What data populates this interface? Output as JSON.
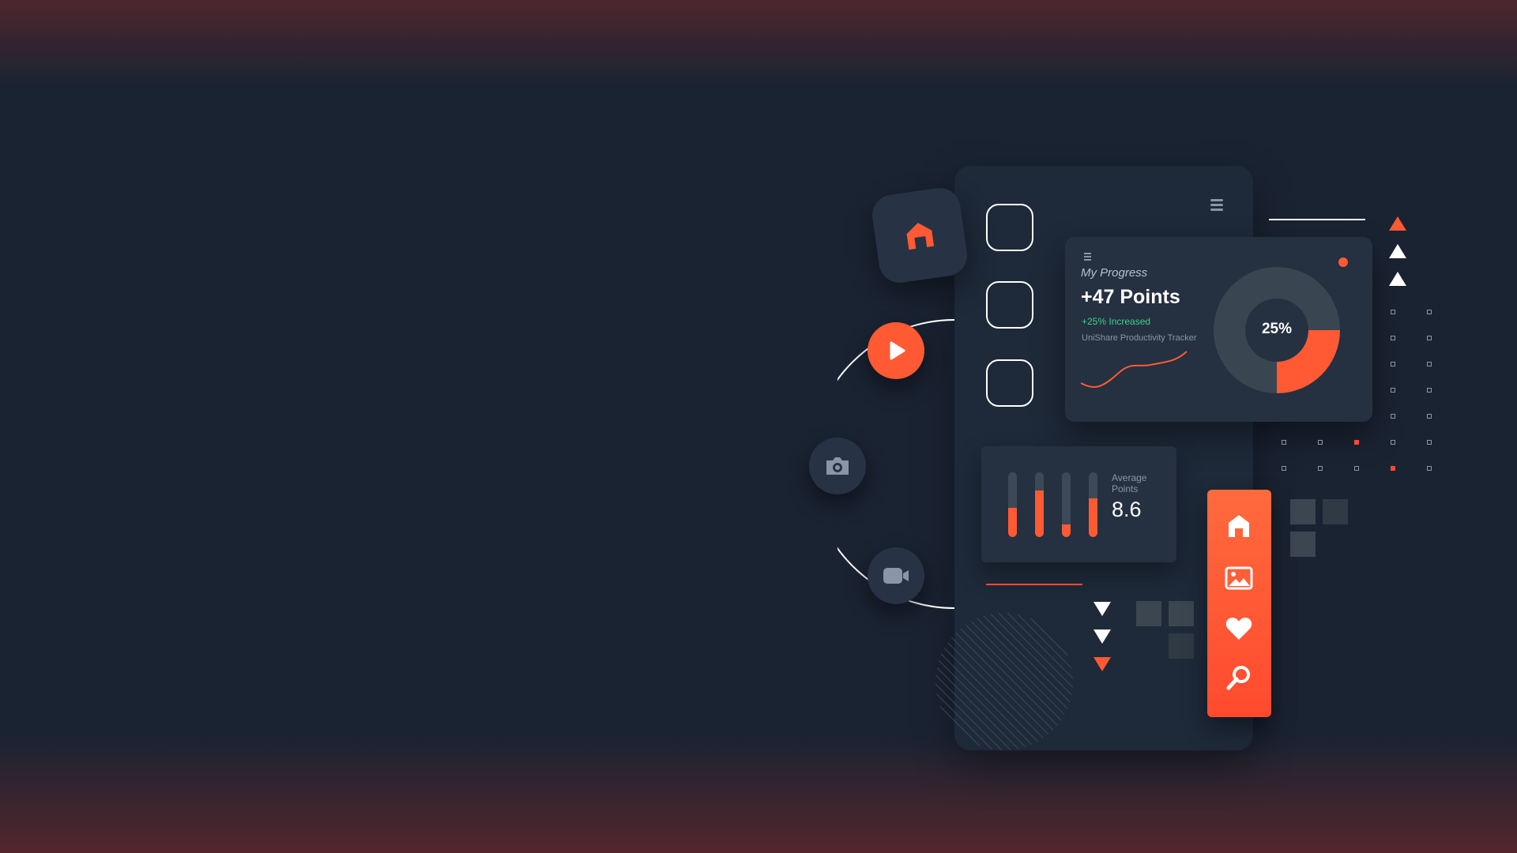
{
  "progress_card": {
    "title": "My Progress",
    "points": "+47 Points",
    "increase": "+25% Increased",
    "subtitle": "UniShare Productivity Tracker",
    "donut_label": "25%",
    "donut_percent": 25
  },
  "average_card": {
    "label": "Average Points",
    "value": "8.6",
    "bar_levels": [
      0.45,
      0.72,
      0.2,
      0.6
    ]
  },
  "colors": {
    "accent": "#ff5a33",
    "background": "#1a2332",
    "panel": "#1e2939",
    "card": "#253041",
    "success": "#3ed08c"
  },
  "icons": {
    "tile": "home-icon",
    "orbit": [
      "play-icon",
      "camera-icon",
      "video-icon"
    ],
    "sidebar": [
      "home-icon",
      "image-icon",
      "heart-icon",
      "search-icon"
    ]
  }
}
